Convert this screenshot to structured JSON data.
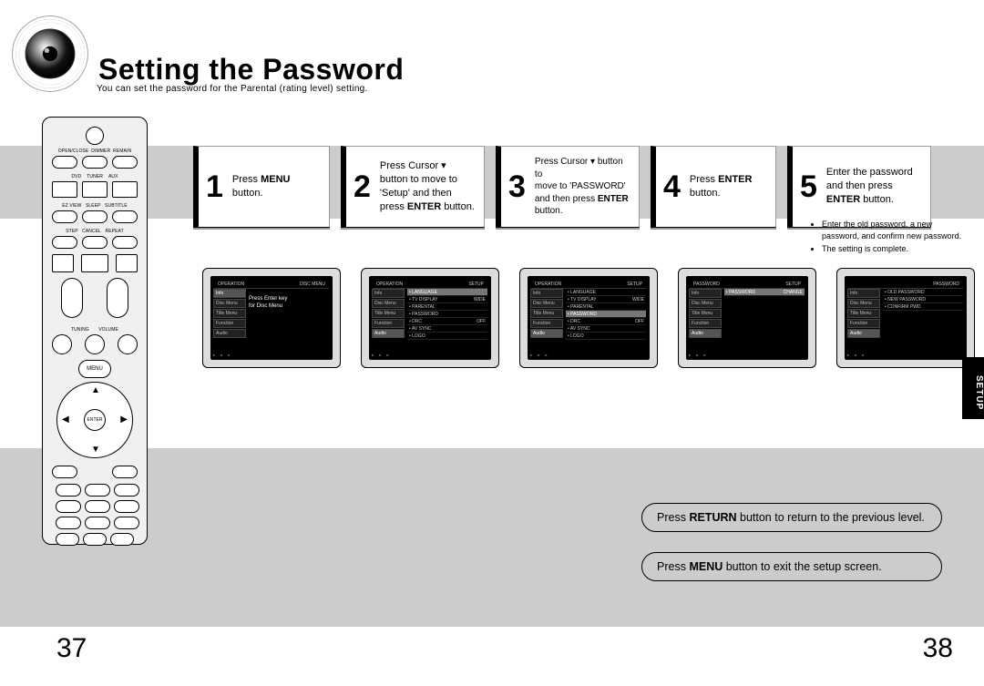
{
  "header": {
    "title": "Setting the Password",
    "subtitle": "You can set the password for the Parental (rating level) setting."
  },
  "remote": {
    "menu_label": "MENU",
    "enter_label": "ENTER",
    "tuning_label": "TUNING",
    "volume_label": "VOLUME"
  },
  "steps": [
    {
      "num": "1",
      "prefix": "Press ",
      "bold1": "MENU",
      "suffix": " button."
    },
    {
      "num": "2",
      "line1": "Press Cursor ▾",
      "line2": "button to move to",
      "line3": "'Setup' and then",
      "line4_pre": "press ",
      "line4_b": "ENTER",
      "line4_post": " button."
    },
    {
      "num": "3",
      "l1": "Press Cursor ▾ button to",
      "l2": "move to 'PASSWORD'",
      "l3_pre": "and then press ",
      "l3_b": "ENTER",
      "l4": "button."
    },
    {
      "num": "4",
      "pre": "Press ",
      "b": "ENTER",
      "post1": "",
      "post2": "button."
    },
    {
      "num": "5",
      "l1": "Enter the password",
      "l2": "and then press",
      "l3_b": "ENTER",
      "l3_post": " button."
    }
  ],
  "bullets": [
    "Enter the old password, a new password, and confirm new password.",
    "The setting is complete."
  ],
  "screens": {
    "common_left": [
      "Info",
      "Disc Menu",
      "Title Menu",
      "Function",
      "Audio"
    ],
    "s1": {
      "top_left": "OPERATION",
      "top_right": "DISC  MENU",
      "msg1": "Press Enter key",
      "msg2": "for Disc Menu"
    },
    "s2": {
      "top_left": "OPERATION",
      "top_right": "SETUP",
      "rows": [
        [
          "LANGUAGE",
          ""
        ],
        [
          "TV DISPLAY",
          "WIDE"
        ],
        [
          "PARENTAL",
          ""
        ],
        [
          "PASSWORD",
          ""
        ],
        [
          "DRC",
          "OFF"
        ],
        [
          "AV SYNC",
          ""
        ],
        [
          "LOGO",
          ""
        ]
      ],
      "selected": 0
    },
    "s3": {
      "top_left": "OPERATION",
      "top_right": "SETUP",
      "rows": [
        [
          "LANGUAGE",
          ""
        ],
        [
          "TV DISPLAY",
          "WIDE"
        ],
        [
          "PARENTAL",
          ""
        ],
        [
          "PASSWORD",
          ""
        ],
        [
          "DRC",
          "OFF"
        ],
        [
          "AV SYNC",
          ""
        ],
        [
          "LOGO",
          ""
        ]
      ],
      "selected": 3
    },
    "s4": {
      "top_left": "PASSWORD",
      "top_right": "SETUP",
      "rows": [
        [
          "PASSWORD",
          "CHANGE"
        ]
      ],
      "selected": 0
    },
    "s5": {
      "top_left": "",
      "top_right": "PASSWORD",
      "rows": [
        [
          "OLD PASSWORD",
          ""
        ],
        [
          "NEW PASSWORD",
          ""
        ],
        [
          "CONFIRM PWD",
          ""
        ]
      ]
    }
  },
  "setup_tab": "SETUP",
  "notes": {
    "n1_pre": "Press ",
    "n1_b": "RETURN",
    "n1_post": " button to return to the previous level.",
    "n2_pre": "Press ",
    "n2_b": "MENU",
    "n2_post": " button to exit the setup screen."
  },
  "pages": {
    "left": "37",
    "right": "38"
  }
}
